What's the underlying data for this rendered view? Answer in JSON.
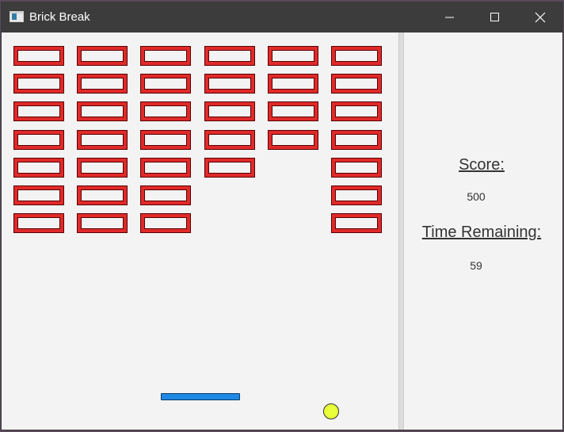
{
  "window": {
    "title": "Brick Break",
    "controls": [
      "minimize",
      "maximize",
      "close"
    ]
  },
  "icons": {
    "app": "brick-break-app-icon",
    "minimize": "minimize-icon",
    "maximize": "maximize-icon",
    "close": "close-icon"
  },
  "colors": {
    "brick": "#e02a2a",
    "paddle": "#1e88e5",
    "ball": "#e8ff3a",
    "titlebar": "#3c3c3c"
  },
  "game": {
    "bricks_per_column_remaining": [
      7,
      7,
      7,
      5,
      4,
      7
    ],
    "brick_grid": {
      "columns": 6,
      "rows": 7,
      "present": [
        [
          1,
          1,
          1,
          1,
          1,
          1
        ],
        [
          1,
          1,
          1,
          1,
          1,
          1
        ],
        [
          1,
          1,
          1,
          1,
          1,
          1
        ],
        [
          1,
          1,
          1,
          1,
          1,
          1
        ],
        [
          1,
          1,
          1,
          1,
          0,
          1
        ],
        [
          1,
          1,
          1,
          0,
          0,
          1
        ],
        [
          1,
          1,
          1,
          0,
          0,
          1
        ]
      ]
    }
  },
  "sidebar": {
    "score_label": "Score:",
    "score_value": "500",
    "time_label": "Time Remaining:",
    "time_value": "59"
  }
}
